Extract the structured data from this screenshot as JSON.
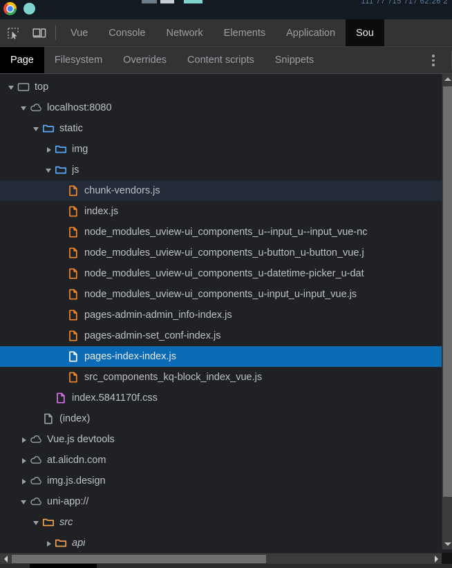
{
  "os_bar": {
    "chrome_icon": "chrome-logo-icon",
    "teal_icon": "teal-circle-icon",
    "clock": "111 77 715 717 62:26 2"
  },
  "devtools": {
    "inspect_icon": "inspect-element-icon",
    "device_toolbar_icon": "device-toolbar-icon",
    "tabs": [
      {
        "label": "Vue",
        "active": false
      },
      {
        "label": "Console",
        "active": false
      },
      {
        "label": "Network",
        "active": false
      },
      {
        "label": "Elements",
        "active": false
      },
      {
        "label": "Application",
        "active": false
      },
      {
        "label": "Sou",
        "active": true
      }
    ],
    "subtabs": [
      {
        "label": "Page",
        "active": true
      },
      {
        "label": "Filesystem",
        "active": false
      },
      {
        "label": "Overrides",
        "active": false
      },
      {
        "label": "Content scripts",
        "active": false
      },
      {
        "label": "Snippets",
        "active": false
      }
    ],
    "more_options_icon": "kebab-menu-icon"
  },
  "tree": {
    "rows": [
      {
        "label": "top",
        "depth": 0,
        "twisty": "open",
        "icon": "frame-icon",
        "state": "none",
        "italic": false
      },
      {
        "label": "localhost:8080",
        "depth": 1,
        "twisty": "open",
        "icon": "cloud-icon",
        "state": "none",
        "italic": false
      },
      {
        "label": "static",
        "depth": 2,
        "twisty": "open",
        "icon": "folder-blue-icon",
        "state": "none",
        "italic": false
      },
      {
        "label": "img",
        "depth": 3,
        "twisty": "closed",
        "icon": "folder-blue-icon",
        "state": "none",
        "italic": false
      },
      {
        "label": "js",
        "depth": 3,
        "twisty": "open",
        "icon": "folder-blue-icon",
        "state": "none",
        "italic": false
      },
      {
        "label": "chunk-vendors.js",
        "depth": 4,
        "twisty": "none",
        "icon": "file-js-icon",
        "state": "hover",
        "italic": false
      },
      {
        "label": "index.js",
        "depth": 4,
        "twisty": "none",
        "icon": "file-js-icon",
        "state": "none",
        "italic": false
      },
      {
        "label": "node_modules_uview-ui_components_u--input_u--input_vue-nc",
        "depth": 4,
        "twisty": "none",
        "icon": "file-js-icon",
        "state": "none",
        "italic": false
      },
      {
        "label": "node_modules_uview-ui_components_u-button_u-button_vue.j",
        "depth": 4,
        "twisty": "none",
        "icon": "file-js-icon",
        "state": "none",
        "italic": false
      },
      {
        "label": "node_modules_uview-ui_components_u-datetime-picker_u-dat",
        "depth": 4,
        "twisty": "none",
        "icon": "file-js-icon",
        "state": "none",
        "italic": false
      },
      {
        "label": "node_modules_uview-ui_components_u-input_u-input_vue.js",
        "depth": 4,
        "twisty": "none",
        "icon": "file-js-icon",
        "state": "none",
        "italic": false
      },
      {
        "label": "pages-admin-admin_info-index.js",
        "depth": 4,
        "twisty": "none",
        "icon": "file-js-icon",
        "state": "none",
        "italic": false
      },
      {
        "label": "pages-admin-set_conf-index.js",
        "depth": 4,
        "twisty": "none",
        "icon": "file-js-icon",
        "state": "none",
        "italic": false
      },
      {
        "label": "pages-index-index.js",
        "depth": 4,
        "twisty": "none",
        "icon": "file-js-selected-icon",
        "state": "selected",
        "italic": false
      },
      {
        "label": "src_components_kq-block_index_vue.js",
        "depth": 4,
        "twisty": "none",
        "icon": "file-js-icon",
        "state": "none",
        "italic": false
      },
      {
        "label": "index.5841170f.css",
        "depth": 3,
        "twisty": "none",
        "icon": "file-css-icon",
        "state": "none",
        "italic": false
      },
      {
        "label": "(index)",
        "depth": 2,
        "twisty": "none",
        "icon": "file-doc-icon",
        "state": "none",
        "italic": false
      },
      {
        "label": "Vue.js devtools",
        "depth": 1,
        "twisty": "closed",
        "icon": "cloud-icon",
        "state": "none",
        "italic": false
      },
      {
        "label": "at.alicdn.com",
        "depth": 1,
        "twisty": "closed",
        "icon": "cloud-icon",
        "state": "none",
        "italic": false
      },
      {
        "label": "img.js.design",
        "depth": 1,
        "twisty": "closed",
        "icon": "cloud-icon",
        "state": "none",
        "italic": false
      },
      {
        "label": "uni-app://",
        "depth": 1,
        "twisty": "open",
        "icon": "cloud-icon",
        "state": "none",
        "italic": false
      },
      {
        "label": "src",
        "depth": 2,
        "twisty": "open",
        "icon": "folder-orange-icon",
        "state": "none",
        "italic": true
      },
      {
        "label": "api",
        "depth": 3,
        "twisty": "closed",
        "icon": "folder-orange-icon",
        "state": "none",
        "italic": true
      }
    ]
  },
  "scrollbars": {
    "vertical_up_icon": "scroll-up-arrow-icon",
    "vertical_down_icon": "scroll-down-arrow-icon",
    "horizontal_left_icon": "scroll-left-arrow-icon",
    "horizontal_right_icon": "scroll-right-arrow-icon"
  },
  "colors": {
    "selection_blue": "#0b6ab4",
    "hover_row": "#242b38",
    "panel_bg": "#202124",
    "toolbar_bg": "#333333",
    "folder_blue": "#5aa9f8",
    "folder_orange": "#f0a050",
    "file_js_orange": "#f4872c",
    "file_css_purple": "#d673e8",
    "text": "#bdc1c6"
  }
}
